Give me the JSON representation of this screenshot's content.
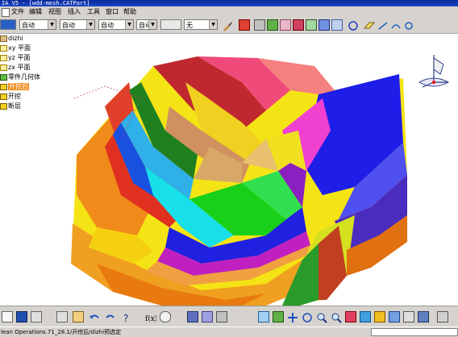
{
  "window": {
    "title": "IA V5 - [wdd-mesh.CATPart]"
  },
  "menu": {
    "items": [
      "文件",
      "编辑",
      "视图",
      "插入",
      "工具",
      "窗口",
      "帮助"
    ]
  },
  "toolbar": {
    "combo1": "",
    "combo2": "自动",
    "combo3": "自动",
    "combo4": "自动",
    "combo5": "自动",
    "combo6": "无"
  },
  "tree": {
    "root": "dizhi",
    "items": [
      "xy 平面",
      "yz 平面",
      "zx 平面",
      "零件几何体",
      "开挖后",
      "开挖",
      "断层"
    ],
    "selected_index": 4
  },
  "status": {
    "text": "lean Operations.71_28.1/开挖后/dizhi预选定"
  },
  "colors": {
    "selection": "#f08a1a",
    "chrome": "#d6d3ce",
    "titlebar": "#1c48c8"
  }
}
